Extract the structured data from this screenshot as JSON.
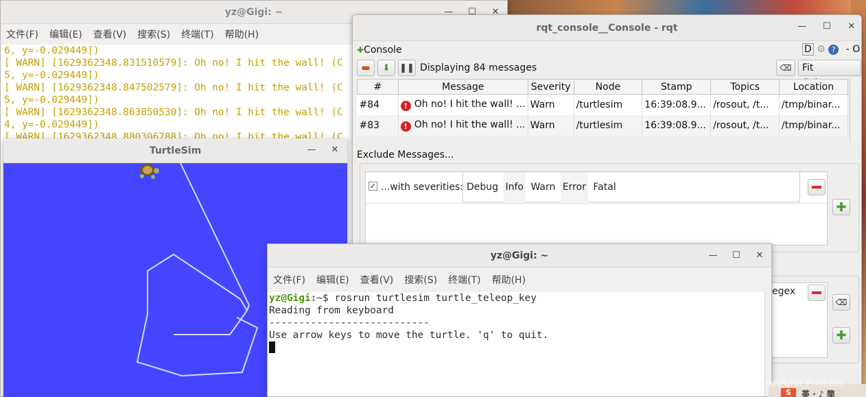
{
  "colors": {
    "terminal_text": "#c4a000",
    "turtle_bg": "#4545ff",
    "warn": "#b38f00",
    "prompt_user": "#4e9a06",
    "prompt_path": "#3465a4"
  },
  "back_terminal": {
    "title": "yz@Gigi: ~",
    "menu": [
      "文件(F)",
      "编辑(E)",
      "查看(V)",
      "搜索(S)",
      "终端(T)",
      "帮助(H)"
    ],
    "lines": [
      "6, y=-0.029449])",
      "[ WARN] [1629362348.831510579]: Oh no! I hit the wall! (C",
      "5, y=-0.029449])",
      "[ WARN] [1629362348.847502579]: Oh no! I hit the wall! (C",
      "5, y=-0.029449])",
      "[ WARN] [1629362348.863850530]: Oh no! I hit the wall! (C",
      "4, y=-0.029449])",
      "[ WARN] [1629362348.880306788]: Oh no! I hit the wall! (C"
    ]
  },
  "turtlesim": {
    "title": "TurtleSim",
    "turtle_icon": "turtle-icon"
  },
  "rqt": {
    "title": "rqt_console__Console - rqt",
    "panel_label": "Console",
    "panel_right": "D",
    "panel_right_extra": "- O",
    "displaying": "Displaying 84 messages",
    "fit_columns": "Fit Columns",
    "columns": [
      "#",
      "Message",
      "Severity",
      "Node",
      "Stamp",
      "Topics",
      "Location"
    ],
    "rows": [
      {
        "num": "#84",
        "message": "Oh no! I hit the wall! ...",
        "severity": "Warn",
        "node": "/turtlesim",
        "stamp": "16:39:08.9...",
        "topics": "/rosout, /t...",
        "location": "/tmp/binar..."
      },
      {
        "num": "#83",
        "message": "Oh no! I hit the wall! ...",
        "severity": "Warn",
        "node": "/turtlesim",
        "stamp": "16:39:08.9...",
        "topics": "/rosout, /t...",
        "location": "/tmp/binar..."
      }
    ],
    "exclude_label": "Exclude Messages...",
    "filter_label": "...with severities:",
    "severities": [
      "Debug",
      "Info",
      "Warn",
      "Error",
      "Fatal"
    ],
    "highlight_regex_label": "egex"
  },
  "front_terminal": {
    "title": "yz@Gigi: ~",
    "menu": [
      "文件(F)",
      "编辑(E)",
      "查看(V)",
      "搜索(S)",
      "终端(T)",
      "帮助(H)"
    ],
    "prompt_user": "yz@Gigi",
    "prompt_path": ":~",
    "prompt_symbol": "$ ",
    "command": "rosrun turtlesim turtle_teleop_key",
    "out1": "Reading from keyboard",
    "out2": "---------------------------",
    "out3": "Use arrow keys to move the turtle. 'q' to quit."
  },
  "watermark": "https://blog.csdn.net/GIGI_Princess",
  "taskbar": {
    "ime_logo": "S",
    "ime_text": "英 · ♪ 简"
  }
}
